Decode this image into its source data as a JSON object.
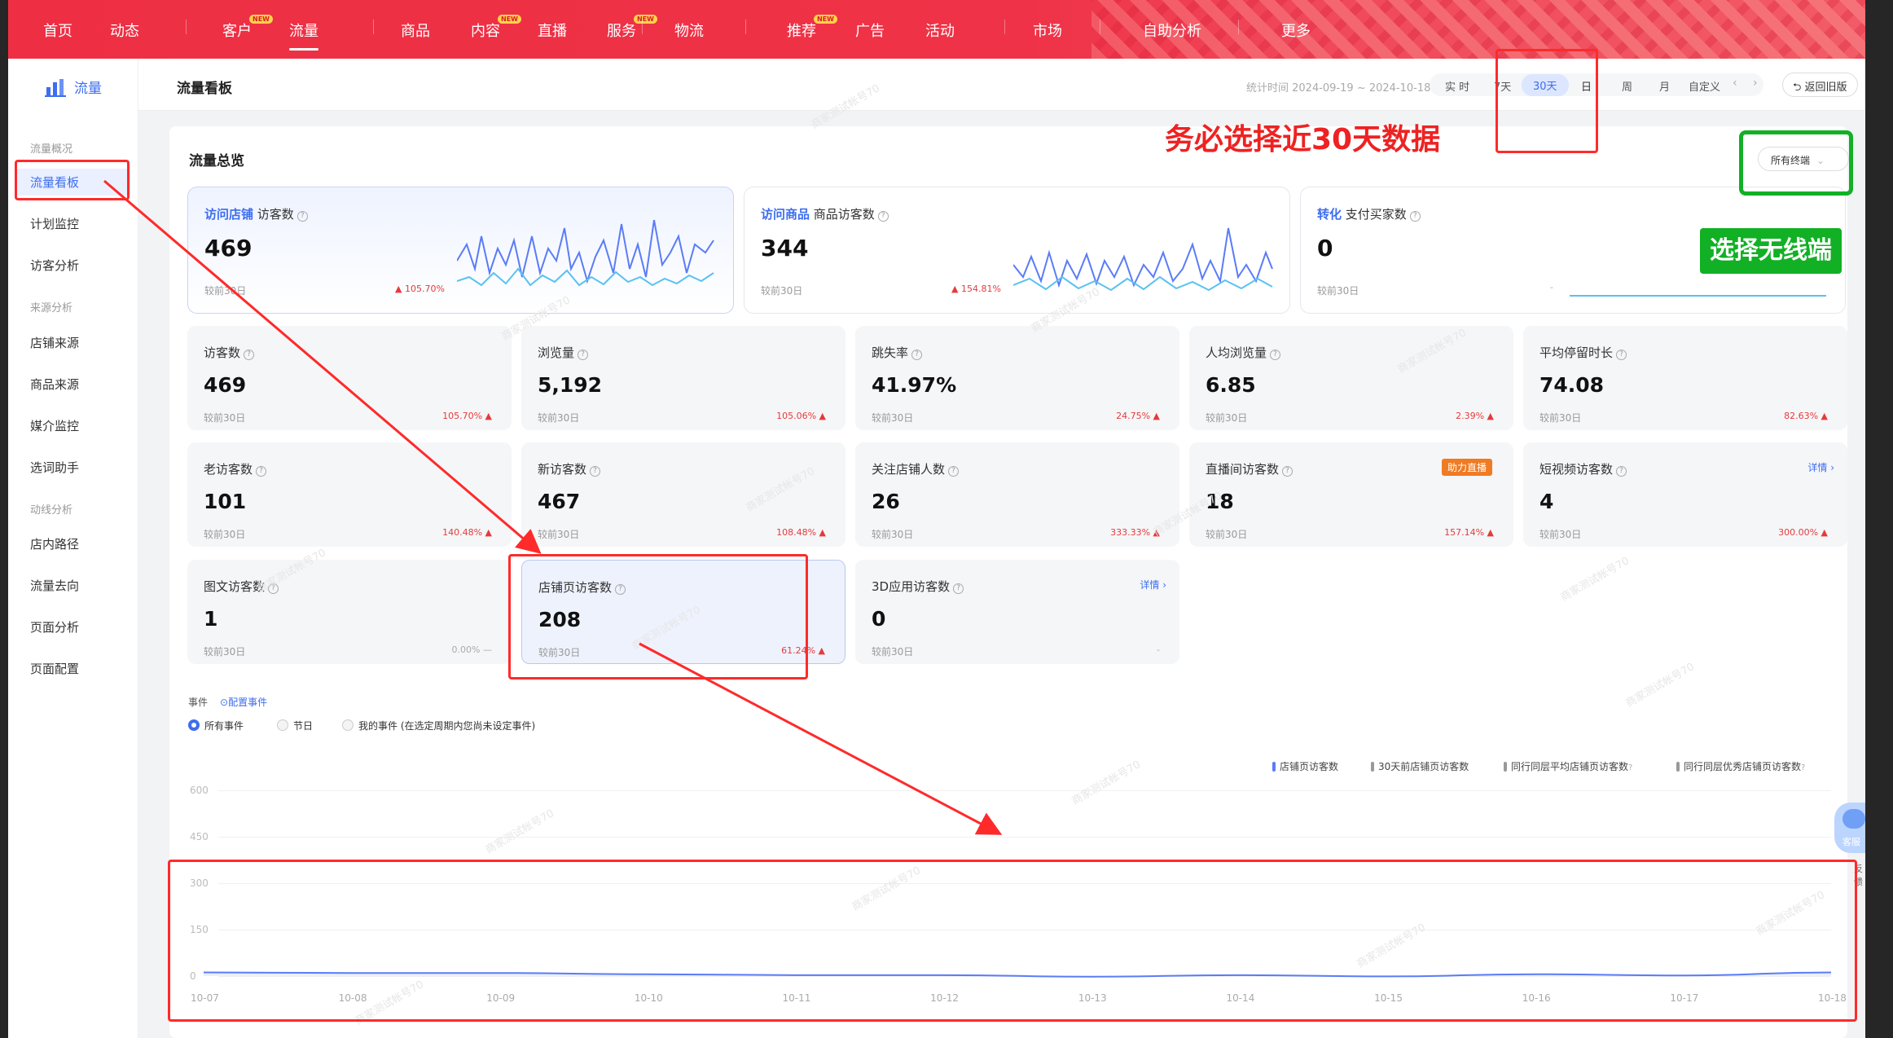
{
  "topnav": {
    "items": [
      {
        "label": "首页",
        "new": false
      },
      {
        "label": "动态",
        "new": false
      },
      {
        "label": "客户",
        "new": true
      },
      {
        "label": "流量",
        "new": false,
        "active": true
      },
      {
        "label": "商品",
        "new": false
      },
      {
        "label": "内容",
        "new": true
      },
      {
        "label": "直播",
        "new": false
      },
      {
        "label": "服务",
        "new": true
      },
      {
        "label": "物流",
        "new": false
      },
      {
        "label": "推荐",
        "new": true
      },
      {
        "label": "广告",
        "new": false
      },
      {
        "label": "活动",
        "new": false
      },
      {
        "label": "市场",
        "new": false
      },
      {
        "label": "自助分析",
        "new": false
      },
      {
        "label": "更多",
        "new": false
      }
    ],
    "new_badge": "NEW"
  },
  "sidebar": {
    "title": "流量",
    "groups": [
      {
        "head": "流量概况",
        "items": [
          "流量看板",
          "计划监控",
          "访客分析"
        ]
      },
      {
        "head": "来源分析",
        "items": [
          "店铺来源",
          "商品来源",
          "媒介监控",
          "选词助手"
        ]
      },
      {
        "head": "动线分析",
        "items": [
          "店内路径",
          "流量去向",
          "页面分析",
          "页面配置"
        ]
      }
    ]
  },
  "header": {
    "title": "流量看板",
    "stat_time": "统计时间 2024-09-19 ~ 2024-10-18",
    "ranges": [
      "实 时",
      "7天",
      "30天",
      "日",
      "周",
      "月",
      "自定义"
    ],
    "active_range": "30天",
    "back_button": "返回旧版"
  },
  "overview": {
    "title": "流量总览",
    "terminal_select": "所有终端",
    "big_cards": [
      {
        "tag": "访问店铺",
        "name": "访客数",
        "value": "469",
        "compare": "较前30日",
        "pct": "105.70%"
      },
      {
        "tag": "访问商品",
        "name": "商品访客数",
        "value": "344",
        "compare": "较前30日",
        "pct": "154.81%"
      },
      {
        "tag": "转化",
        "name": "支付买家数",
        "value": "0",
        "compare": "较前30日",
        "pct": "-"
      }
    ],
    "metrics": [
      {
        "name": "访客数",
        "value": "469",
        "compare": "较前30日",
        "pct": "105.70%"
      },
      {
        "name": "浏览量",
        "value": "5,192",
        "compare": "较前30日",
        "pct": "105.06%"
      },
      {
        "name": "跳失率",
        "value": "41.97%",
        "compare": "较前30日",
        "pct": "24.75%"
      },
      {
        "name": "人均浏览量",
        "value": "6.85",
        "compare": "较前30日",
        "pct": "2.39%"
      },
      {
        "name": "平均停留时长",
        "value": "74.08",
        "compare": "较前30日",
        "pct": "82.63%"
      },
      {
        "name": "老访客数",
        "value": "101",
        "compare": "较前30日",
        "pct": "140.48%"
      },
      {
        "name": "新访客数",
        "value": "467",
        "compare": "较前30日",
        "pct": "108.48%"
      },
      {
        "name": "关注店铺人数",
        "value": "26",
        "compare": "较前30日",
        "pct": "333.33%"
      },
      {
        "name": "直播间访客数",
        "value": "18",
        "compare": "较前30日",
        "pct": "157.14%",
        "badge": "助力直播"
      },
      {
        "name": "短视频访客数",
        "value": "4",
        "compare": "较前30日",
        "pct": "300.00%",
        "link": "详情"
      },
      {
        "name": "图文访客数",
        "value": "1",
        "compare": "较前30日",
        "pct": "0.00%"
      },
      {
        "name": "店铺页访客数",
        "value": "208",
        "compare": "较前30日",
        "pct": "61.24%"
      },
      {
        "name": "3D应用访客数",
        "value": "0",
        "compare": "较前30日",
        "pct": "-",
        "link": "详情"
      }
    ]
  },
  "events": {
    "label": "事件",
    "config_link": "配置事件",
    "options": [
      "所有事件",
      "节日",
      "我的事件 (在选定周期内您尚未设定事件)"
    ],
    "selected": "所有事件"
  },
  "chart_data": {
    "type": "line",
    "x": [
      "10-07",
      "10-08",
      "10-09",
      "10-10",
      "10-11",
      "10-12",
      "10-13",
      "10-14",
      "10-15",
      "10-16",
      "10-17",
      "10-18"
    ],
    "yticks": [
      0,
      150,
      300,
      450,
      600
    ],
    "ylim": [
      0,
      600
    ],
    "series": [
      {
        "name": "店铺页访客数",
        "color": "#5b7cf6",
        "values": [
          12,
          10,
          10,
          6,
          3,
          3,
          -2,
          3,
          -1,
          6,
          2,
          12
        ]
      }
    ],
    "legend": [
      "店铺页访客数",
      "30天前店铺页访客数",
      "同行同层平均店铺页访客数",
      "同行同层优秀店铺页访客数"
    ],
    "legend_colors": [
      "#5b7cf6",
      "#999999",
      "#999999",
      "#999999"
    ]
  },
  "annotations": {
    "select_30": "务必选择近30天数据",
    "select_wireless": "选择无线端"
  },
  "float": {
    "service": "客服",
    "feedback": "反馈"
  },
  "watermark": "商家测试帐号70"
}
